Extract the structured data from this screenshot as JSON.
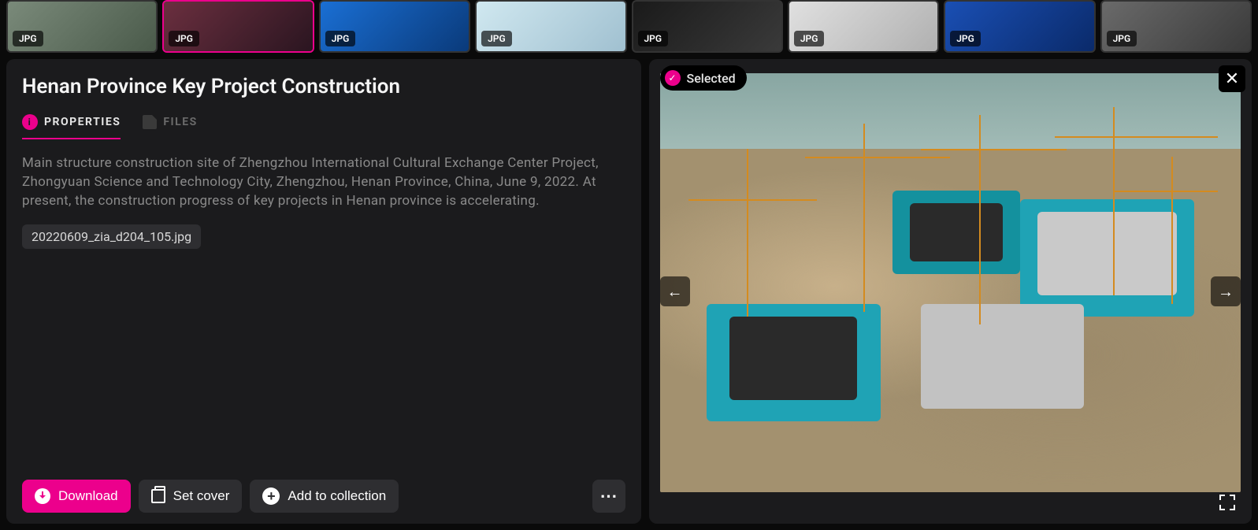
{
  "thumbnails": [
    {
      "format": "JPG",
      "selected": false
    },
    {
      "format": "JPG",
      "selected": true
    },
    {
      "format": "JPG",
      "selected": false
    },
    {
      "format": "JPG",
      "selected": false
    },
    {
      "format": "JPG",
      "selected": false
    },
    {
      "format": "JPG",
      "selected": false
    },
    {
      "format": "JPG",
      "selected": false
    },
    {
      "format": "JPG",
      "selected": false
    }
  ],
  "detail": {
    "title": "Henan Province Key Project Construction",
    "tabs": {
      "properties": "PROPERTIES",
      "files": "FILES"
    },
    "description": "Main structure construction site of Zhengzhou International Cultural Exchange Center Project, Zhongyuan Science and Technology City, Zhengzhou, Henan Province, China, June 9, 2022. At present, the construction progress of key projects in Henan province is accelerating.",
    "filename": "20220609_zia_d204_105.jpg"
  },
  "actions": {
    "download": "Download",
    "set_cover": "Set cover",
    "add_to_collection": "Add to collection"
  },
  "preview": {
    "selected_label": "Selected"
  }
}
